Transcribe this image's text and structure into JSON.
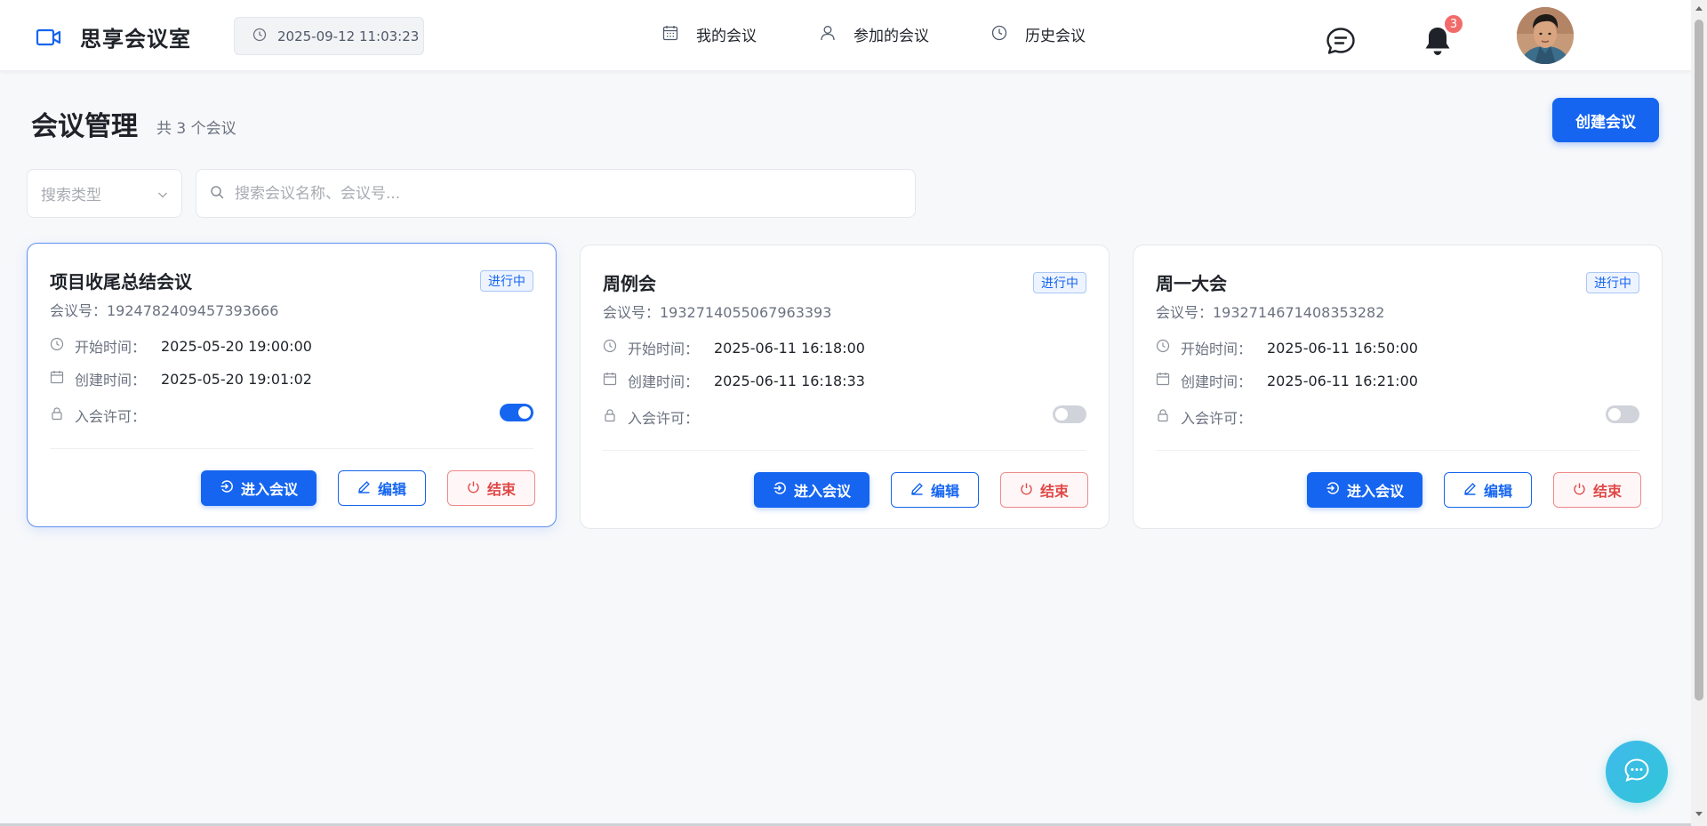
{
  "app": {
    "name": "思享会议室",
    "datetime": "2025-09-12 11:03:23"
  },
  "nav": {
    "my_meetings": "我的会议",
    "joined_meetings": "参加的会议",
    "history_meetings": "历史会议"
  },
  "notifications": {
    "count": "3"
  },
  "page": {
    "title": "会议管理",
    "count_text": "共 3 个会议",
    "create_button": "创建会议"
  },
  "search": {
    "type_placeholder": "搜索类型",
    "input_placeholder": "搜索会议名称、会议号..."
  },
  "labels": {
    "meeting_id_prefix": "会议号：",
    "start_time": "开始时间：",
    "created_time": "创建时间：",
    "join_permission": "入会许可：",
    "enter": "进入会议",
    "edit": "编辑",
    "end": "结束"
  },
  "meetings": [
    {
      "title": "项目收尾总结会议",
      "status": "进行中",
      "meeting_id": "会议号：1924782409457393666",
      "start_time": "2025-05-20 19:00:00",
      "created_time": "2025-05-20 19:01:02",
      "join_permission": true
    },
    {
      "title": "周例会",
      "status": "进行中",
      "meeting_id": "会议号：1932714055067963393",
      "start_time": "2025-06-11 16:18:00",
      "created_time": "2025-06-11 16:18:33",
      "join_permission": false
    },
    {
      "title": "周一大会",
      "status": "进行中",
      "meeting_id": "会议号：1932714671408353282",
      "start_time": "2025-06-11 16:50:00",
      "created_time": "2025-06-11 16:21:00",
      "join_permission": false
    }
  ],
  "colors": {
    "primary": "#1565f0",
    "danger": "#e04848",
    "fab": "#3fb9ea"
  }
}
